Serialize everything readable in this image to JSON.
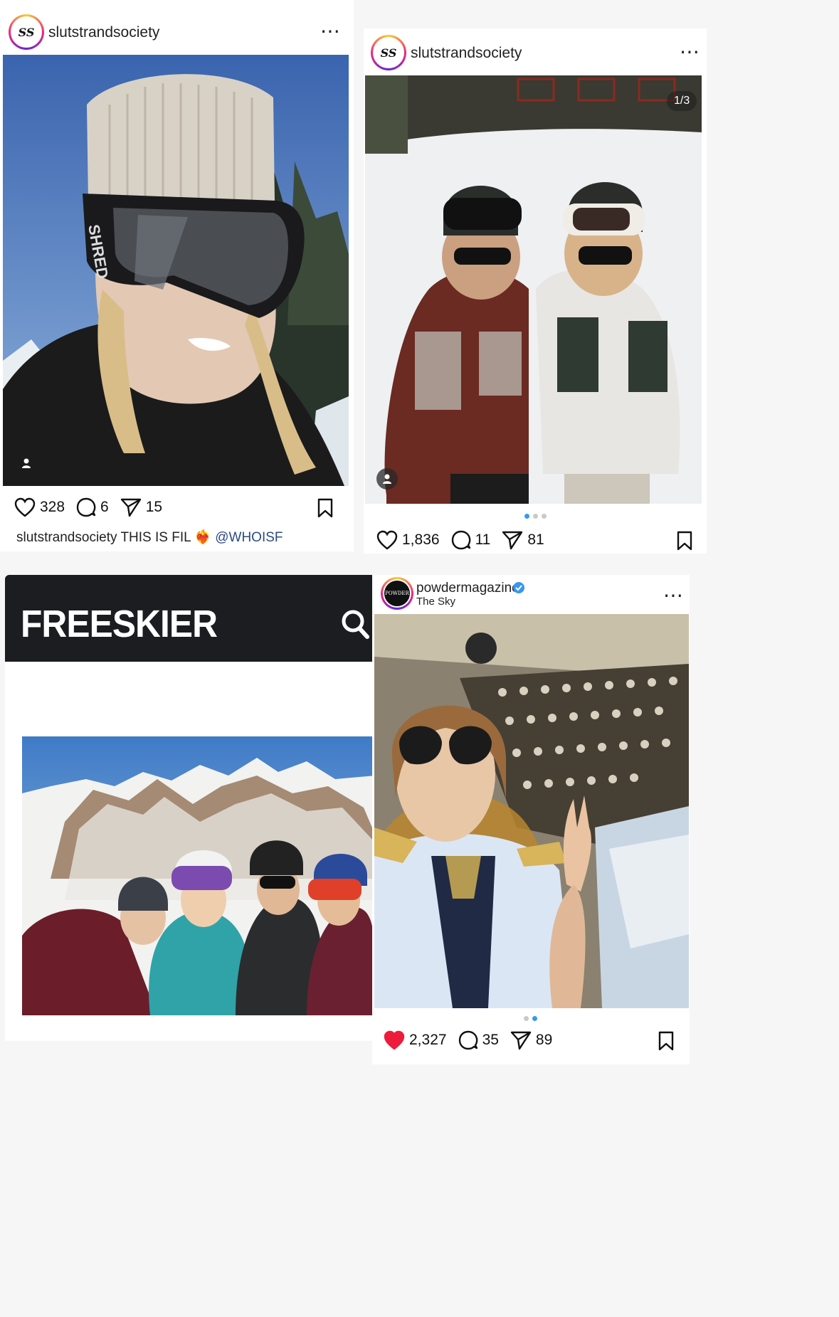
{
  "posts": [
    {
      "username": "slutstrandsociety",
      "avatar_text": "SS",
      "likes": "328",
      "comments": "6",
      "shares": "15",
      "caption_user": "slutstrandsociety",
      "caption_text": "THIS IS FIL",
      "caption_emoji": "❤️‍🔥",
      "caption_mention": "@WHOISF"
    },
    {
      "username": "slutstrandsociety",
      "avatar_text": "SS",
      "counter": "1/3",
      "likes": "1,836",
      "comments": "11",
      "shares": "81"
    },
    {
      "site_title": "FREESKIER"
    },
    {
      "username": "powdermagazine",
      "avatar_text": "POWDER",
      "location": "The Sky",
      "likes": "2,327",
      "comments": "35",
      "shares": "89"
    }
  ],
  "colors": {
    "verified": "#3897f0",
    "liked": "#ed1c3a",
    "freeskier_bar": "#1c1d21"
  }
}
